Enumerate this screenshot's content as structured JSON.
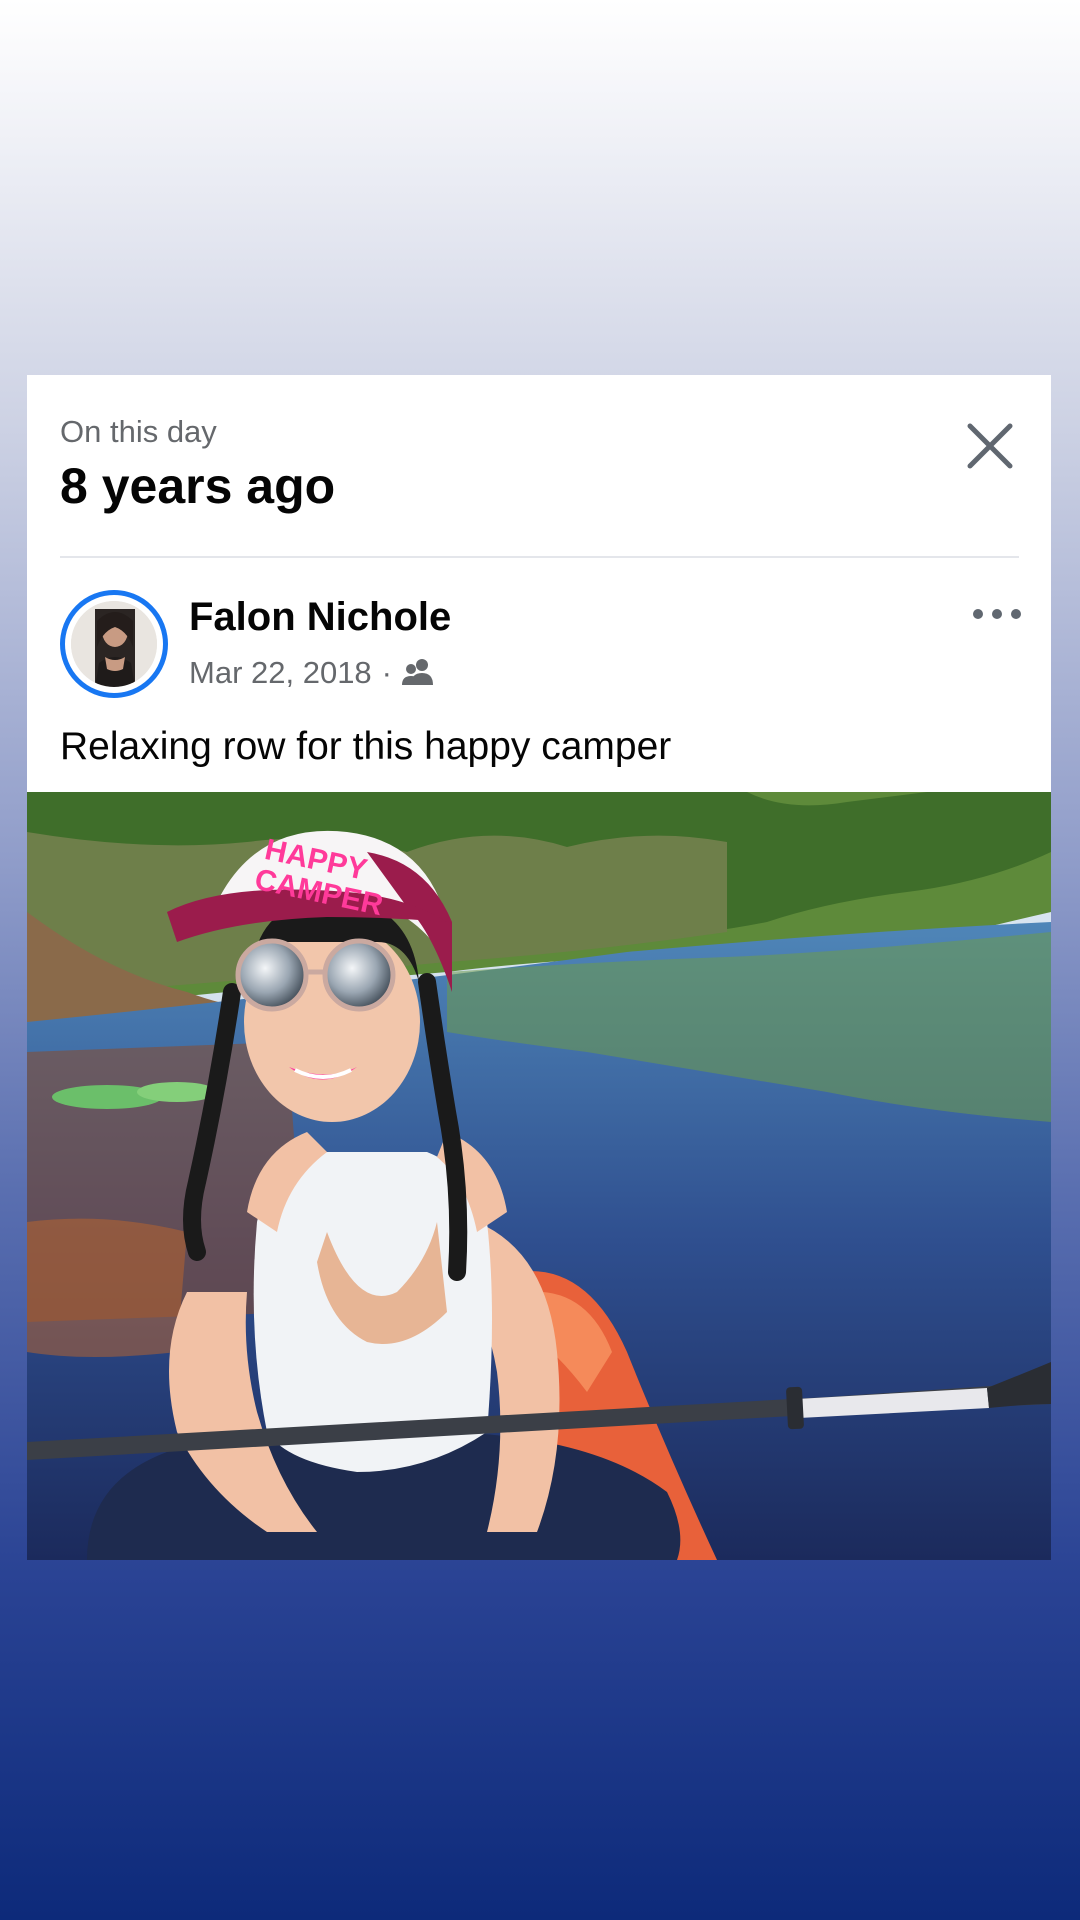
{
  "memory": {
    "eyebrow": "On this day",
    "headline": "8 years ago",
    "close_label": "close"
  },
  "post": {
    "author": "Falon Nichole",
    "date": "Mar 22, 2018",
    "separator": "·",
    "audience_icon": "friends-icon",
    "caption": "Relaxing row for this happy camper",
    "photo_hat_text_1": "HAPPY",
    "photo_hat_text_2": "CAMPER"
  },
  "colors": {
    "accent": "#1877f2",
    "text_primary": "#050505",
    "text_secondary": "#65686c",
    "icon": "#606770"
  },
  "icons": {
    "close": "close-icon",
    "more": "more-options-icon",
    "audience": "friends-icon"
  }
}
